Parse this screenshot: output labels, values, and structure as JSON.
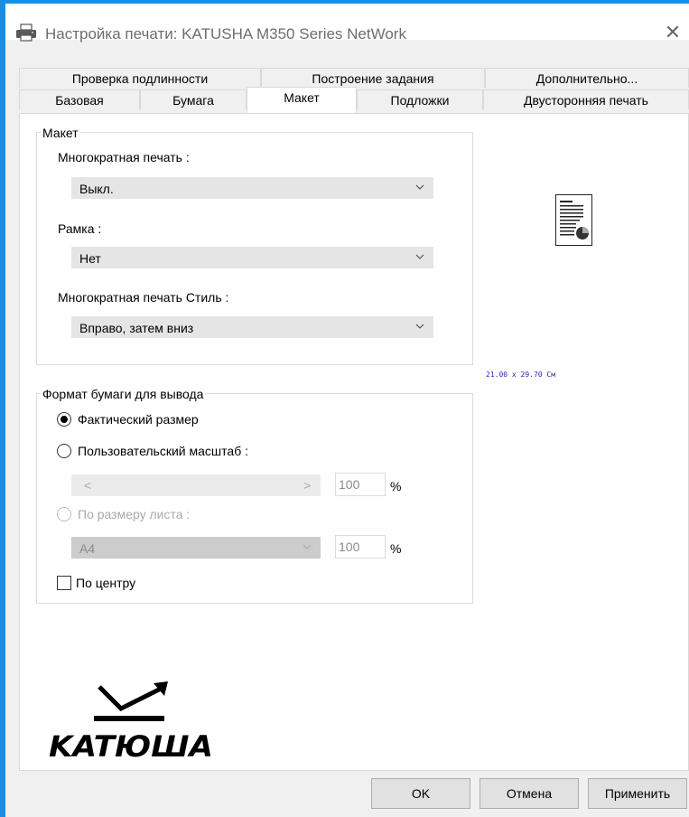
{
  "window": {
    "title": "Настройка печати: KATUSHA M350 Series NetWork",
    "close_label": "✕"
  },
  "tabs_row1": [
    "Проверка подлинности",
    "Построение задания",
    "Дополнительно..."
  ],
  "tabs_row2": [
    "Базовая",
    "Бумага",
    "Макет",
    "Подложки",
    "Двусторонняя печать"
  ],
  "active_tab": "Макет",
  "layout_group": {
    "title": "Макет",
    "multiple_print_label": "Многократная печать :",
    "multiple_print_value": "Выкл.",
    "frame_label": "Рамка :",
    "frame_value": "Нет",
    "style_label": "Многократная печать Стиль :",
    "style_value": "Вправо, затем вниз"
  },
  "output_group": {
    "title": "Формат бумаги для вывода",
    "actual_size_label": "Фактический размер",
    "actual_size_selected": true,
    "custom_scale_label": "Пользовательский масштаб :",
    "custom_scale_value": "100",
    "slider_left": "<",
    "slider_right": ">",
    "fit_to_page_label": "По размеру листа :",
    "fit_to_page_paper": "A4",
    "fit_to_page_value": "100",
    "percent_sign": "%",
    "center_label": "По центру",
    "center_checked": false
  },
  "preview": {
    "paper_size_text": "21.00 x 29.70 Cм"
  },
  "logo": {
    "text": "KATЮША"
  },
  "buttons": {
    "ok": "OK",
    "cancel": "Отмена",
    "apply": "Применить"
  }
}
